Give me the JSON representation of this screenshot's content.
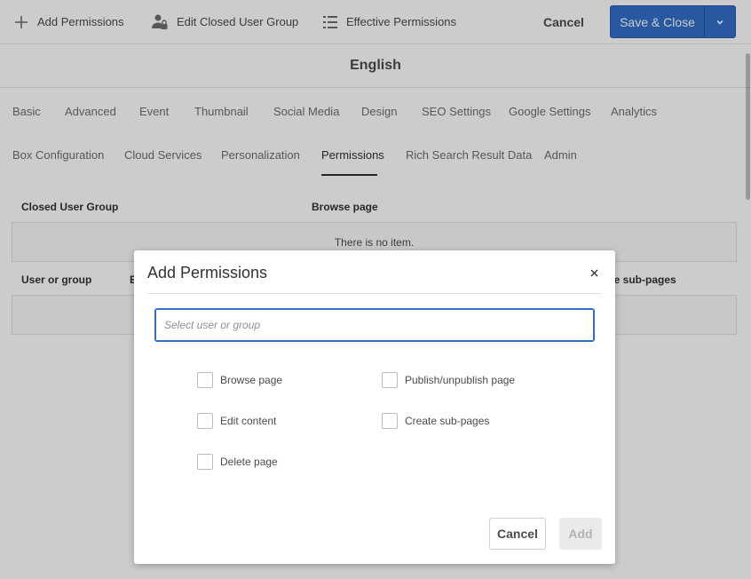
{
  "toolbar": {
    "add_permissions": "Add Permissions",
    "edit_cug": "Edit Closed User Group",
    "effective_permissions": "Effective Permissions",
    "cancel": "Cancel",
    "save_close": "Save & Close",
    "accent_color": "#326ec8"
  },
  "page": {
    "title": "English"
  },
  "tabs_row1": [
    "Basic",
    "Advanced",
    "Event",
    "Thumbnail",
    "Social Media",
    "Design",
    "SEO Settings",
    "Google Settings",
    "Analytics"
  ],
  "tabs_row2": [
    "Box Configuration",
    "Cloud Services",
    "Personalization",
    "Permissions",
    "Rich Search Result Data",
    "Admin"
  ],
  "active_tab": "Permissions",
  "cug_table": {
    "headers": [
      "Closed User Group",
      "Browse page"
    ],
    "empty_text": "There is no item."
  },
  "perm_table": {
    "headers": [
      "User or group",
      "E",
      "ate sub-pages"
    ]
  },
  "dialog": {
    "title": "Add Permissions",
    "input_placeholder": "Select user or group",
    "checkboxes": [
      "Browse page",
      "Publish/unpublish page",
      "Edit content",
      "Create sub-pages",
      "Delete page"
    ],
    "cancel": "Cancel",
    "add": "Add"
  }
}
